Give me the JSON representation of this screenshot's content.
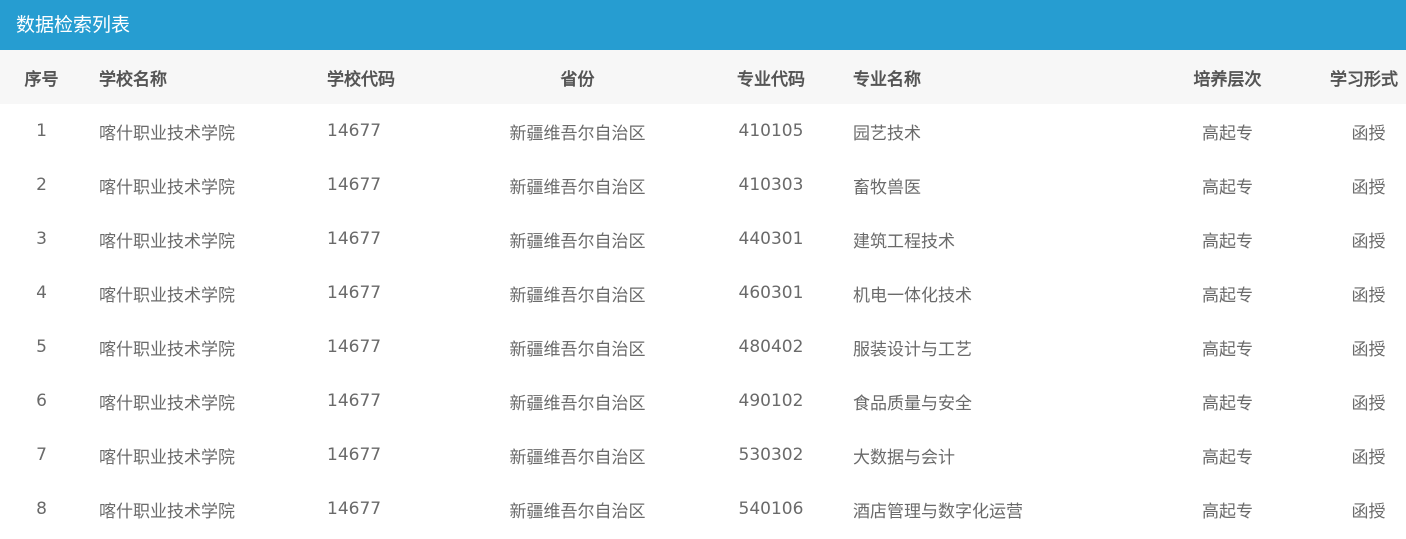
{
  "header": {
    "title": "数据检索列表"
  },
  "table": {
    "columns": [
      "序号",
      "学校名称",
      "学校代码",
      "省份",
      "专业代码",
      "专业名称",
      "培养层次",
      "学习形式"
    ],
    "rows": [
      [
        "1",
        "喀什职业技术学院",
        "14677",
        "新疆维吾尔自治区",
        "410105",
        "园艺技术",
        "高起专",
        "函授"
      ],
      [
        "2",
        "喀什职业技术学院",
        "14677",
        "新疆维吾尔自治区",
        "410303",
        "畜牧兽医",
        "高起专",
        "函授"
      ],
      [
        "3",
        "喀什职业技术学院",
        "14677",
        "新疆维吾尔自治区",
        "440301",
        "建筑工程技术",
        "高起专",
        "函授"
      ],
      [
        "4",
        "喀什职业技术学院",
        "14677",
        "新疆维吾尔自治区",
        "460301",
        "机电一体化技术",
        "高起专",
        "函授"
      ],
      [
        "5",
        "喀什职业技术学院",
        "14677",
        "新疆维吾尔自治区",
        "480402",
        "服装设计与工艺",
        "高起专",
        "函授"
      ],
      [
        "6",
        "喀什职业技术学院",
        "14677",
        "新疆维吾尔自治区",
        "490102",
        "食品质量与安全",
        "高起专",
        "函授"
      ],
      [
        "7",
        "喀什职业技术学院",
        "14677",
        "新疆维吾尔自治区",
        "530302",
        "大数据与会计",
        "高起专",
        "函授"
      ],
      [
        "8",
        "喀什职业技术学院",
        "14677",
        "新疆维吾尔自治区",
        "540106",
        "酒店管理与数字化运营",
        "高起专",
        "函授"
      ]
    ]
  }
}
